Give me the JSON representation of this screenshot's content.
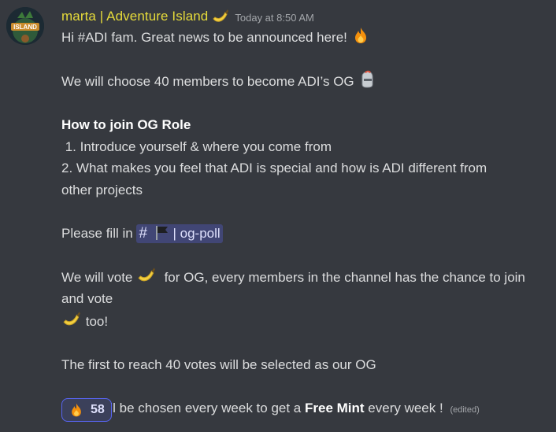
{
  "message": {
    "author": "marta | Adventure Island",
    "author_emoji": "banana-icon",
    "avatar_text": "ISLAND",
    "timestamp": "Today at 8:50 AM",
    "lines": {
      "intro": "Hi #ADI fam. Great news to be announced here!",
      "choose": "We will choose 40 members to become ADI’s OG",
      "how_title": "How to join OG Role",
      "step1": " 1. Introduce yourself & where you come from",
      "step2": " 2. What makes you feel that ADI is special and how is ADI different from other projects",
      "fill_prefix": "Please fill in",
      "vote_a": "We will vote",
      "vote_b": " for OG, every members in the channel has the chance to join and vote",
      "vote_c": " too!",
      "first": "The first to reach 40 votes will be selected as our OG",
      "mint_a": "1 OG will be chosen every week to get a ",
      "mint_bold": "Free Mint",
      "mint_b": " every week !",
      "edited": "(edited)"
    },
    "channel_mention": {
      "hash": "#",
      "icon": "black-flag-icon",
      "name": "| og-poll"
    }
  },
  "reactions": [
    {
      "emoji": "fire-icon",
      "count": "58"
    }
  ],
  "colors": {
    "background": "#36393f",
    "username": "#e6db3a",
    "text": "#dcddde",
    "mention_bg": "#414675",
    "reaction_border": "#5865f2"
  }
}
